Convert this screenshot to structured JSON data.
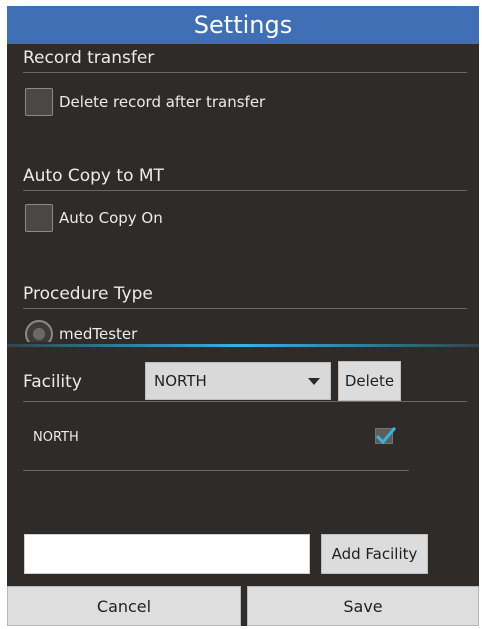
{
  "title": "Settings",
  "sections": {
    "record_transfer": {
      "title": "Record transfer",
      "checkbox_label": "Delete record after transfer",
      "checked": false
    },
    "auto_copy": {
      "title": "Auto Copy to MT",
      "checkbox_label": "Auto Copy On",
      "checked": false
    },
    "procedure_type": {
      "title": "Procedure Type",
      "radio_label": "medTester"
    }
  },
  "facility": {
    "label": "Facility",
    "selected": "NORTH",
    "delete_label": "Delete",
    "items": [
      {
        "name": "NORTH",
        "checked": true
      }
    ],
    "add_input_value": "",
    "add_button_label": "Add Facility"
  },
  "footer": {
    "cancel_label": "Cancel",
    "save_label": "Save"
  },
  "colors": {
    "title_bar": "#3f6fb5",
    "background": "#2e2b28",
    "accent": "#33b5e5"
  },
  "icons": {
    "dropdown": "chevron-down-icon",
    "item_check": "checkmark-icon"
  }
}
